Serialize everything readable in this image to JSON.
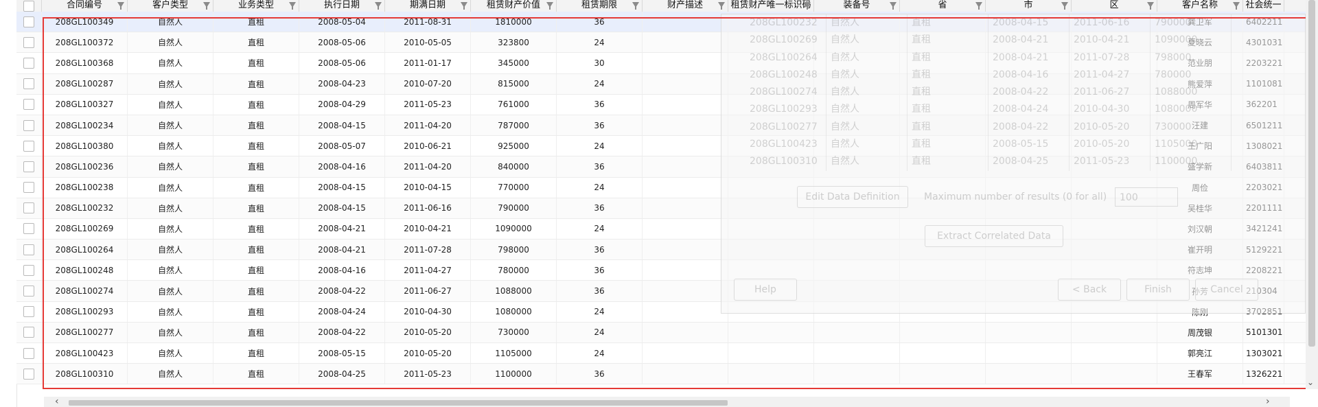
{
  "columns": [
    {
      "label": "",
      "w": 37
    },
    {
      "label": "合同编号",
      "w": 125
    },
    {
      "label": "客户类型",
      "w": 125
    },
    {
      "label": "业务类型",
      "w": 125
    },
    {
      "label": "执行日期",
      "w": 125
    },
    {
      "label": "期满日期",
      "w": 125
    },
    {
      "label": "租赁财产价值",
      "w": 125
    },
    {
      "label": "租赁期限",
      "w": 125
    },
    {
      "label": "财产描述",
      "w": 125
    },
    {
      "label": "租赁财产唯一标识码",
      "w": 125
    },
    {
      "label": "装备号",
      "w": 125
    },
    {
      "label": "省",
      "w": 125
    },
    {
      "label": "市",
      "w": 125
    },
    {
      "label": "区",
      "w": 125
    },
    {
      "label": "客户名称",
      "w": 125
    },
    {
      "label": "社会统一",
      "w": 60
    }
  ],
  "rows": [
    [
      "208GL100349",
      "自然人",
      "直租",
      "2008-05-04",
      "2011-08-31",
      "1810000",
      "36",
      "",
      "",
      "",
      "",
      "",
      "",
      "龚卫军",
      "6402211"
    ],
    [
      "208GL100372",
      "自然人",
      "直租",
      "2008-05-06",
      "2010-05-05",
      "323800",
      "24",
      "",
      "",
      "",
      "",
      "",
      "",
      "夏晓云",
      "4301031"
    ],
    [
      "208GL100368",
      "自然人",
      "直租",
      "2008-05-06",
      "2011-01-17",
      "345000",
      "30",
      "",
      "",
      "",
      "",
      "",
      "",
      "范业朋",
      "2203221"
    ],
    [
      "208GL100287",
      "自然人",
      "直租",
      "2008-04-23",
      "2010-07-20",
      "815000",
      "24",
      "",
      "",
      "",
      "",
      "",
      "",
      "熊爱萍",
      "1101081"
    ],
    [
      "208GL100327",
      "自然人",
      "直租",
      "2008-04-29",
      "2011-05-23",
      "761000",
      "36",
      "",
      "",
      "",
      "",
      "",
      "",
      "周军华",
      "362201"
    ],
    [
      "208GL100234",
      "自然人",
      "直租",
      "2008-04-15",
      "2011-04-20",
      "787000",
      "36",
      "",
      "",
      "",
      "",
      "",
      "",
      "汪建",
      "6501211"
    ],
    [
      "208GL100380",
      "自然人",
      "直租",
      "2008-05-07",
      "2010-06-21",
      "925000",
      "24",
      "",
      "",
      "",
      "",
      "",
      "",
      "王广阳",
      "1308021"
    ],
    [
      "208GL100236",
      "自然人",
      "直租",
      "2008-04-16",
      "2011-04-20",
      "840000",
      "36",
      "",
      "",
      "",
      "",
      "",
      "",
      "盛学新",
      "6403811"
    ],
    [
      "208GL100238",
      "自然人",
      "直租",
      "2008-04-15",
      "2010-04-15",
      "770000",
      "24",
      "",
      "",
      "",
      "",
      "",
      "",
      "周俭",
      "2203021"
    ],
    [
      "208GL100232",
      "自然人",
      "直租",
      "2008-04-15",
      "2011-06-16",
      "790000",
      "36",
      "",
      "",
      "",
      "",
      "",
      "",
      "吴桂华",
      "2201111"
    ],
    [
      "208GL100269",
      "自然人",
      "直租",
      "2008-04-21",
      "2010-04-21",
      "1090000",
      "24",
      "",
      "",
      "",
      "",
      "",
      "",
      "刘汉朝",
      "3421241"
    ],
    [
      "208GL100264",
      "自然人",
      "直租",
      "2008-04-21",
      "2011-07-28",
      "798000",
      "36",
      "",
      "",
      "",
      "",
      "",
      "",
      "崔开明",
      "5129221"
    ],
    [
      "208GL100248",
      "自然人",
      "直租",
      "2008-04-16",
      "2011-04-27",
      "780000",
      "36",
      "",
      "",
      "",
      "",
      "",
      "",
      "符志坤",
      "2208221"
    ],
    [
      "208GL100274",
      "自然人",
      "直租",
      "2008-04-22",
      "2011-06-27",
      "1088000",
      "36",
      "",
      "",
      "",
      "",
      "",
      "",
      "孙芳",
      "210304"
    ],
    [
      "208GL100293",
      "自然人",
      "直租",
      "2008-04-24",
      "2010-04-30",
      "1080000",
      "24",
      "",
      "",
      "",
      "",
      "",
      "",
      "陈刚",
      "3702851"
    ],
    [
      "208GL100277",
      "自然人",
      "直租",
      "2008-04-22",
      "2010-05-20",
      "730000",
      "24",
      "",
      "",
      "",
      "",
      "",
      "",
      "周茂银",
      "5101301"
    ],
    [
      "208GL100423",
      "自然人",
      "直租",
      "2008-05-15",
      "2010-05-20",
      "1105000",
      "24",
      "",
      "",
      "",
      "",
      "",
      "",
      "郭亮江",
      "1303021"
    ],
    [
      "208GL100310",
      "自然人",
      "直租",
      "2008-04-25",
      "2011-05-23",
      "1100000",
      "36",
      "",
      "",
      "",
      "",
      "",
      "",
      "王春军",
      "1326221"
    ]
  ],
  "ghost": {
    "rows": [
      [
        "208GL100232",
        "自然人",
        "直租",
        "2008-04-15",
        "2011-06-16",
        "790000"
      ],
      [
        "208GL100269",
        "自然人",
        "直租",
        "2008-04-21",
        "2010-04-21",
        "1090000"
      ],
      [
        "208GL100264",
        "自然人",
        "直租",
        "2008-04-21",
        "2011-07-28",
        "798000"
      ],
      [
        "208GL100248",
        "自然人",
        "直租",
        "2008-04-16",
        "2011-04-27",
        "780000"
      ],
      [
        "208GL100274",
        "自然人",
        "直租",
        "2008-04-22",
        "2011-06-27",
        "1088000"
      ],
      [
        "208GL100293",
        "自然人",
        "直租",
        "2008-04-24",
        "2010-04-30",
        "1080000"
      ],
      [
        "208GL100277",
        "自然人",
        "直租",
        "2008-04-22",
        "2010-05-20",
        "730000"
      ],
      [
        "208GL100423",
        "自然人",
        "直租",
        "2008-05-15",
        "2010-05-20",
        "1105000"
      ],
      [
        "208GL100310",
        "自然人",
        "直租",
        "2008-04-25",
        "2011-05-23",
        "1100000"
      ]
    ],
    "edit_btn": "Edit Data Definition",
    "max_label": "Maximum number of results (0 for all)",
    "max_value": "100",
    "extract_btn": "Extract Correlated Data",
    "help_btn": "Help",
    "back_btn": "< Back",
    "finish_btn": "Finish",
    "cancel_btn": "Cancel"
  },
  "colors": {
    "selected_row": "#e8eefc",
    "frame": "#e53935"
  }
}
